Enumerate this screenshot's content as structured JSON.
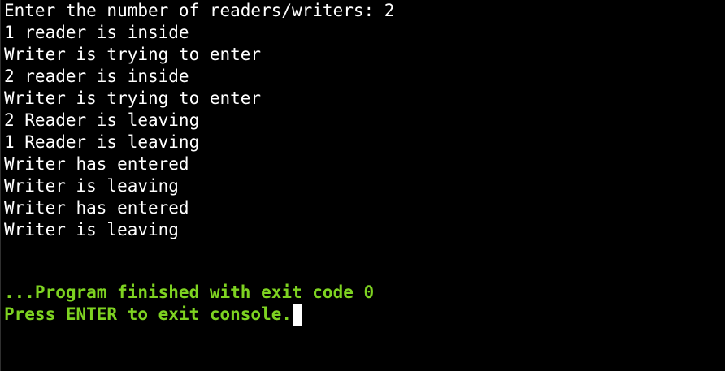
{
  "console": {
    "text_color": "#ffffff",
    "status_color": "#7ed321",
    "background_color": "#000000",
    "output": [
      "Enter the number of readers/writers: 2",
      "1 reader is inside",
      "Writer is trying to enter",
      "2 reader is inside",
      "Writer is trying to enter",
      "2 Reader is leaving",
      "1 Reader is leaving",
      "Writer has entered",
      "Writer is leaving",
      "Writer has entered",
      "Writer is leaving"
    ],
    "finished_message": "...Program finished with exit code 0",
    "exit_prompt": "Press ENTER to exit console."
  }
}
